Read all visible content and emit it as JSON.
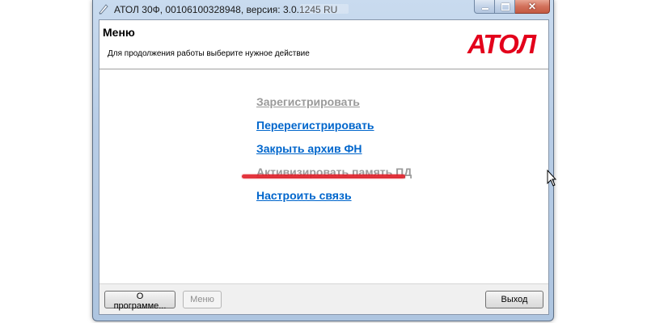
{
  "window": {
    "title": "АТОЛ 30Ф, 00106100328948, версия: 3.0.1245 RU",
    "close_symbol": "✕"
  },
  "header": {
    "title": "Меню",
    "subtitle": "Для продолжения работы выберите нужное действие",
    "logo_text": "АТОЛ",
    "logo_color": "#e3001b"
  },
  "menu": {
    "items": [
      {
        "label": "Зарегистрировать",
        "state": "disabled"
      },
      {
        "label": "Перерегистрировать",
        "state": "active"
      },
      {
        "label": "Закрыть архив ФН",
        "state": "active",
        "highlighted": true
      },
      {
        "label": "Активизировать память ПД",
        "state": "disabled"
      },
      {
        "label": "Настроить связь",
        "state": "active"
      }
    ],
    "link_color": "#0066cc",
    "disabled_color": "#9a9a9a",
    "highlight_color": "#e0202a"
  },
  "footer": {
    "about_label": "О программе...",
    "menu_label": "Меню",
    "exit_label": "Выход"
  },
  "icons": [
    "app-icon",
    "minimize-icon",
    "maximize-icon",
    "close-icon",
    "atol-logo",
    "mouse-cursor-icon"
  ]
}
